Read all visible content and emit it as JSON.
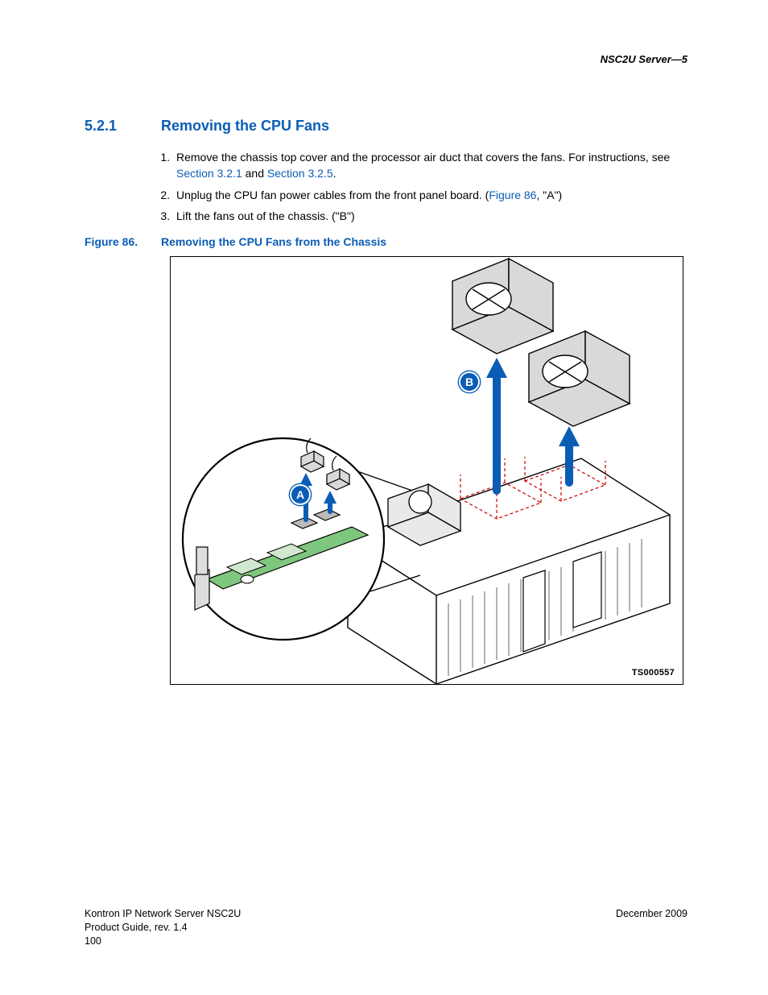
{
  "running_head": "NSC2U Server—5",
  "section": {
    "number": "5.2.1",
    "title": "Removing the CPU Fans"
  },
  "steps": [
    {
      "pre": "Remove the chassis top cover and the processor air duct that covers the fans. For instructions, see ",
      "link1": "Section 3.2.1",
      "mid": " and ",
      "link2": "Section 3.2.5",
      "post": "."
    },
    {
      "pre": "Unplug the CPU fan power cables from the front panel board. (",
      "link1": "Figure 86",
      "mid": "",
      "link2": "",
      "post": ", \"A\")"
    },
    {
      "pre": "Lift the fans out of the chassis. (\"B\")",
      "link1": "",
      "mid": "",
      "link2": "",
      "post": ""
    }
  ],
  "figure": {
    "number": "Figure 86.",
    "title": "Removing the CPU Fans from the Chassis",
    "ts": "TS000557",
    "callouts": {
      "A": "A",
      "B": "B"
    }
  },
  "footer": {
    "line1": "Kontron IP Network Server NSC2U",
    "line2": "Product Guide, rev. 1.4",
    "page": "100",
    "date": "December 2009"
  }
}
